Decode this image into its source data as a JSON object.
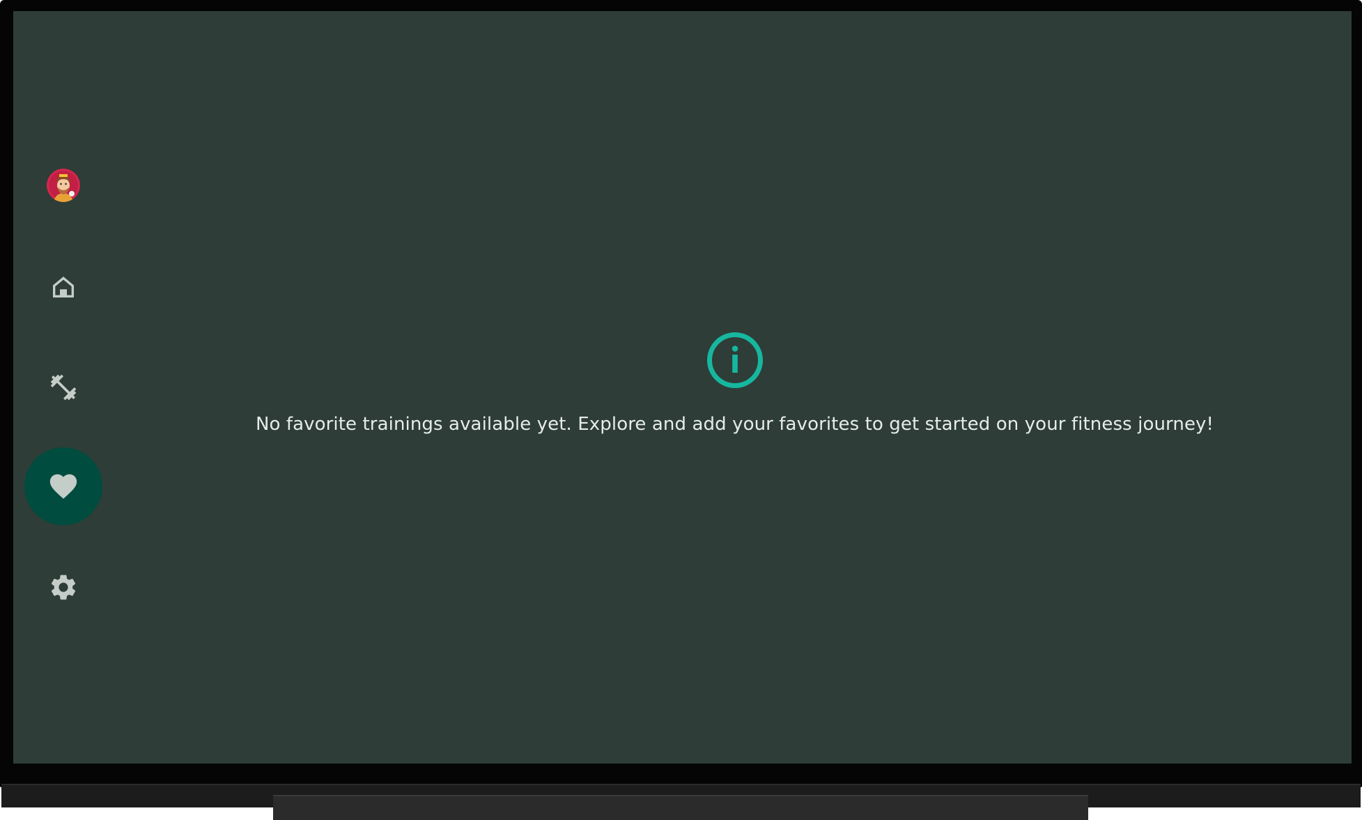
{
  "nav": {
    "items": [
      {
        "id": "profile",
        "icon": "avatar-icon"
      },
      {
        "id": "home",
        "icon": "home-icon"
      },
      {
        "id": "trainings",
        "icon": "dumbbell-icon"
      },
      {
        "id": "favorites",
        "icon": "heart-icon",
        "selected": true
      },
      {
        "id": "settings",
        "icon": "gear-icon"
      }
    ]
  },
  "empty_state": {
    "icon": "info-icon",
    "message": "No favorite trainings available yet. Explore and add your favorites to get started on your fitness journey!"
  },
  "colors": {
    "background": "#2e3d37",
    "accent": "#17b79f",
    "selected_nav": "#004c3f",
    "icon": "#c5cdc9",
    "text": "#e6ece9"
  }
}
